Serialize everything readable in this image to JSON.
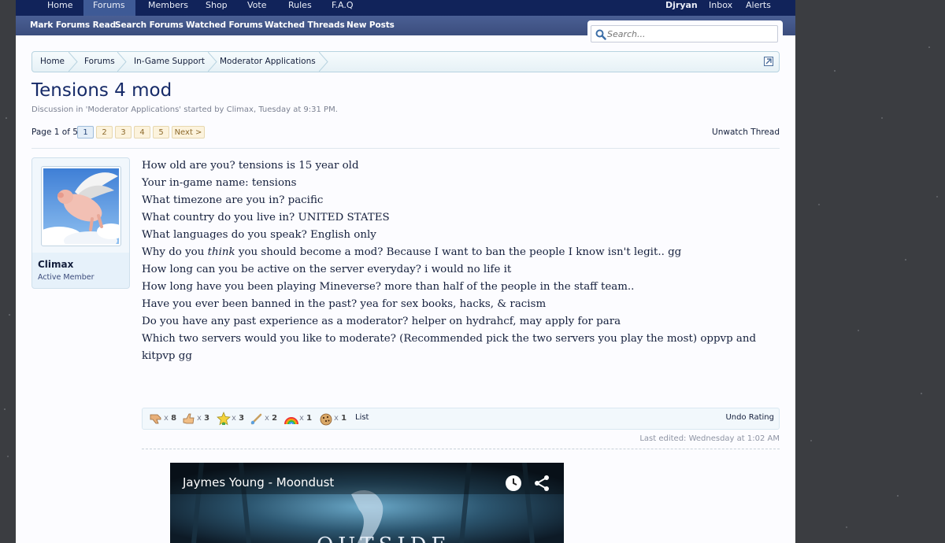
{
  "topnav": {
    "items": [
      "Home",
      "Forums",
      "Members",
      "Shop",
      "Vote",
      "Rules",
      "F.A.Q"
    ],
    "active": "Forums",
    "right": [
      "Djryan",
      "Inbox",
      "Alerts"
    ]
  },
  "subnav": {
    "items": [
      "Mark Forums Read",
      "Search Forums",
      "Watched Forums",
      "Watched Threads",
      "New Posts"
    ]
  },
  "search": {
    "placeholder": "Search..."
  },
  "breadcrumb": [
    "Home",
    "Forums",
    "In-Game Support",
    "Moderator Applications"
  ],
  "thread": {
    "title": "Tensions 4 mod",
    "meta": "Discussion in 'Moderator Applications' started by Climax, Tuesday at 9:31 PM.",
    "page_label": "Page 1 of 5",
    "pages": [
      "1",
      "2",
      "3",
      "4",
      "5"
    ],
    "current_page": "1",
    "next_label": "Next >",
    "unwatch": "Unwatch Thread"
  },
  "user": {
    "name": "Climax",
    "title": "Active Member"
  },
  "post": {
    "lines": [
      "How old are you? tensions is 15 year old",
      "Your in-game name: tensions",
      "What timezone are you in? pacific",
      "What country do you live in? UNITED STATES",
      "What languages do you speak? English only"
    ],
    "why_pre": "Why do you ",
    "why_em": "think",
    "why_post": " you should become a mod? Because I want to ban the people I know isn't legit.. gg",
    "lines2": [
      "How long can you be active on the server everyday? i would no life it",
      "How long have you been playing Mineverse? more than half of the people in the staff team..",
      "Have you ever been banned in the past? yea for sex books, hacks, & racism",
      "Do you have any past experience as a moderator? helper on hydrahcf, may apply for para"
    ],
    "last": "Which two servers would you like to moderate? (Recommended pick the two servers you play the most) oppvp and kitpvp gg"
  },
  "ratings": {
    "items": [
      {
        "icon": "thumbs-down-icon",
        "x": "x",
        "count": "8"
      },
      {
        "icon": "thumbs-up-icon",
        "x": "x",
        "count": "3"
      },
      {
        "icon": "winner-star-icon",
        "x": "x",
        "count": "3"
      },
      {
        "icon": "paintbrush-icon",
        "x": "x",
        "count": "2"
      },
      {
        "icon": "rainbow-icon",
        "x": "x",
        "count": "1"
      },
      {
        "icon": "cookie-icon",
        "x": "x",
        "count": "1"
      }
    ],
    "list_label": "List",
    "undo_label": "Undo Rating"
  },
  "edited": "Last edited: Wednesday at 1:02 AM",
  "video": {
    "title": "Jaymes Young - Moondust",
    "art_text": "OUTSIDE"
  }
}
